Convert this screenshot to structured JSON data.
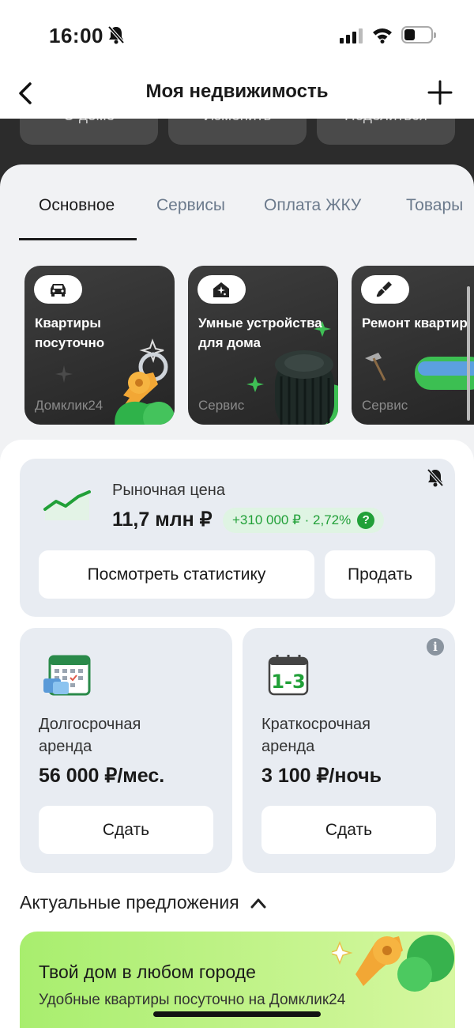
{
  "status_bar": {
    "time": "16:00"
  },
  "nav": {
    "title": "Моя недвижимость"
  },
  "top_actions": [
    "О доме",
    "Изменить",
    "Поделиться"
  ],
  "tabs": [
    {
      "label": "Основное",
      "active": true
    },
    {
      "label": "Сервисы",
      "active": false
    },
    {
      "label": "Оплата ЖКУ",
      "active": false
    },
    {
      "label": "Товары",
      "active": false
    }
  ],
  "services": [
    {
      "title_line1": "Квартиры",
      "title_line2": "посуточно",
      "footer": "Домклик24",
      "icon": "car-icon"
    },
    {
      "title_line1": "Умные устройства",
      "title_line2": "для дома",
      "footer": "Сервис",
      "icon": "smart-home-icon"
    },
    {
      "title_line1": "Ремонт квартир",
      "title_line2": "",
      "footer": "Сервис",
      "icon": "brush-icon"
    }
  ],
  "market": {
    "label": "Рыночная цена",
    "price": "11,7 млн ₽",
    "delta": "+310 000 ₽ · 2,72%",
    "help": "?",
    "stats_button": "Посмотреть статистику",
    "sell_button": "Продать"
  },
  "rent": {
    "long": {
      "line1": "Долгосрочная",
      "line2": "аренда",
      "price": "56 000 ₽/мес.",
      "button": "Сдать"
    },
    "short": {
      "line1": "Краткосрочная",
      "line2": "аренда",
      "price": "3 100 ₽/ночь",
      "button": "Сдать",
      "calendar_text": "1-3"
    }
  },
  "offers": {
    "section_title": "Актуальные предложения",
    "promo_title": "Твой дом в любом городе",
    "promo_subtitle": "Удобные квартиры посуточно на Домклик24"
  },
  "colors": {
    "accent_green": "#21a038",
    "promo_green": "#a8ee6e",
    "card_bg": "#e8ecf2"
  }
}
